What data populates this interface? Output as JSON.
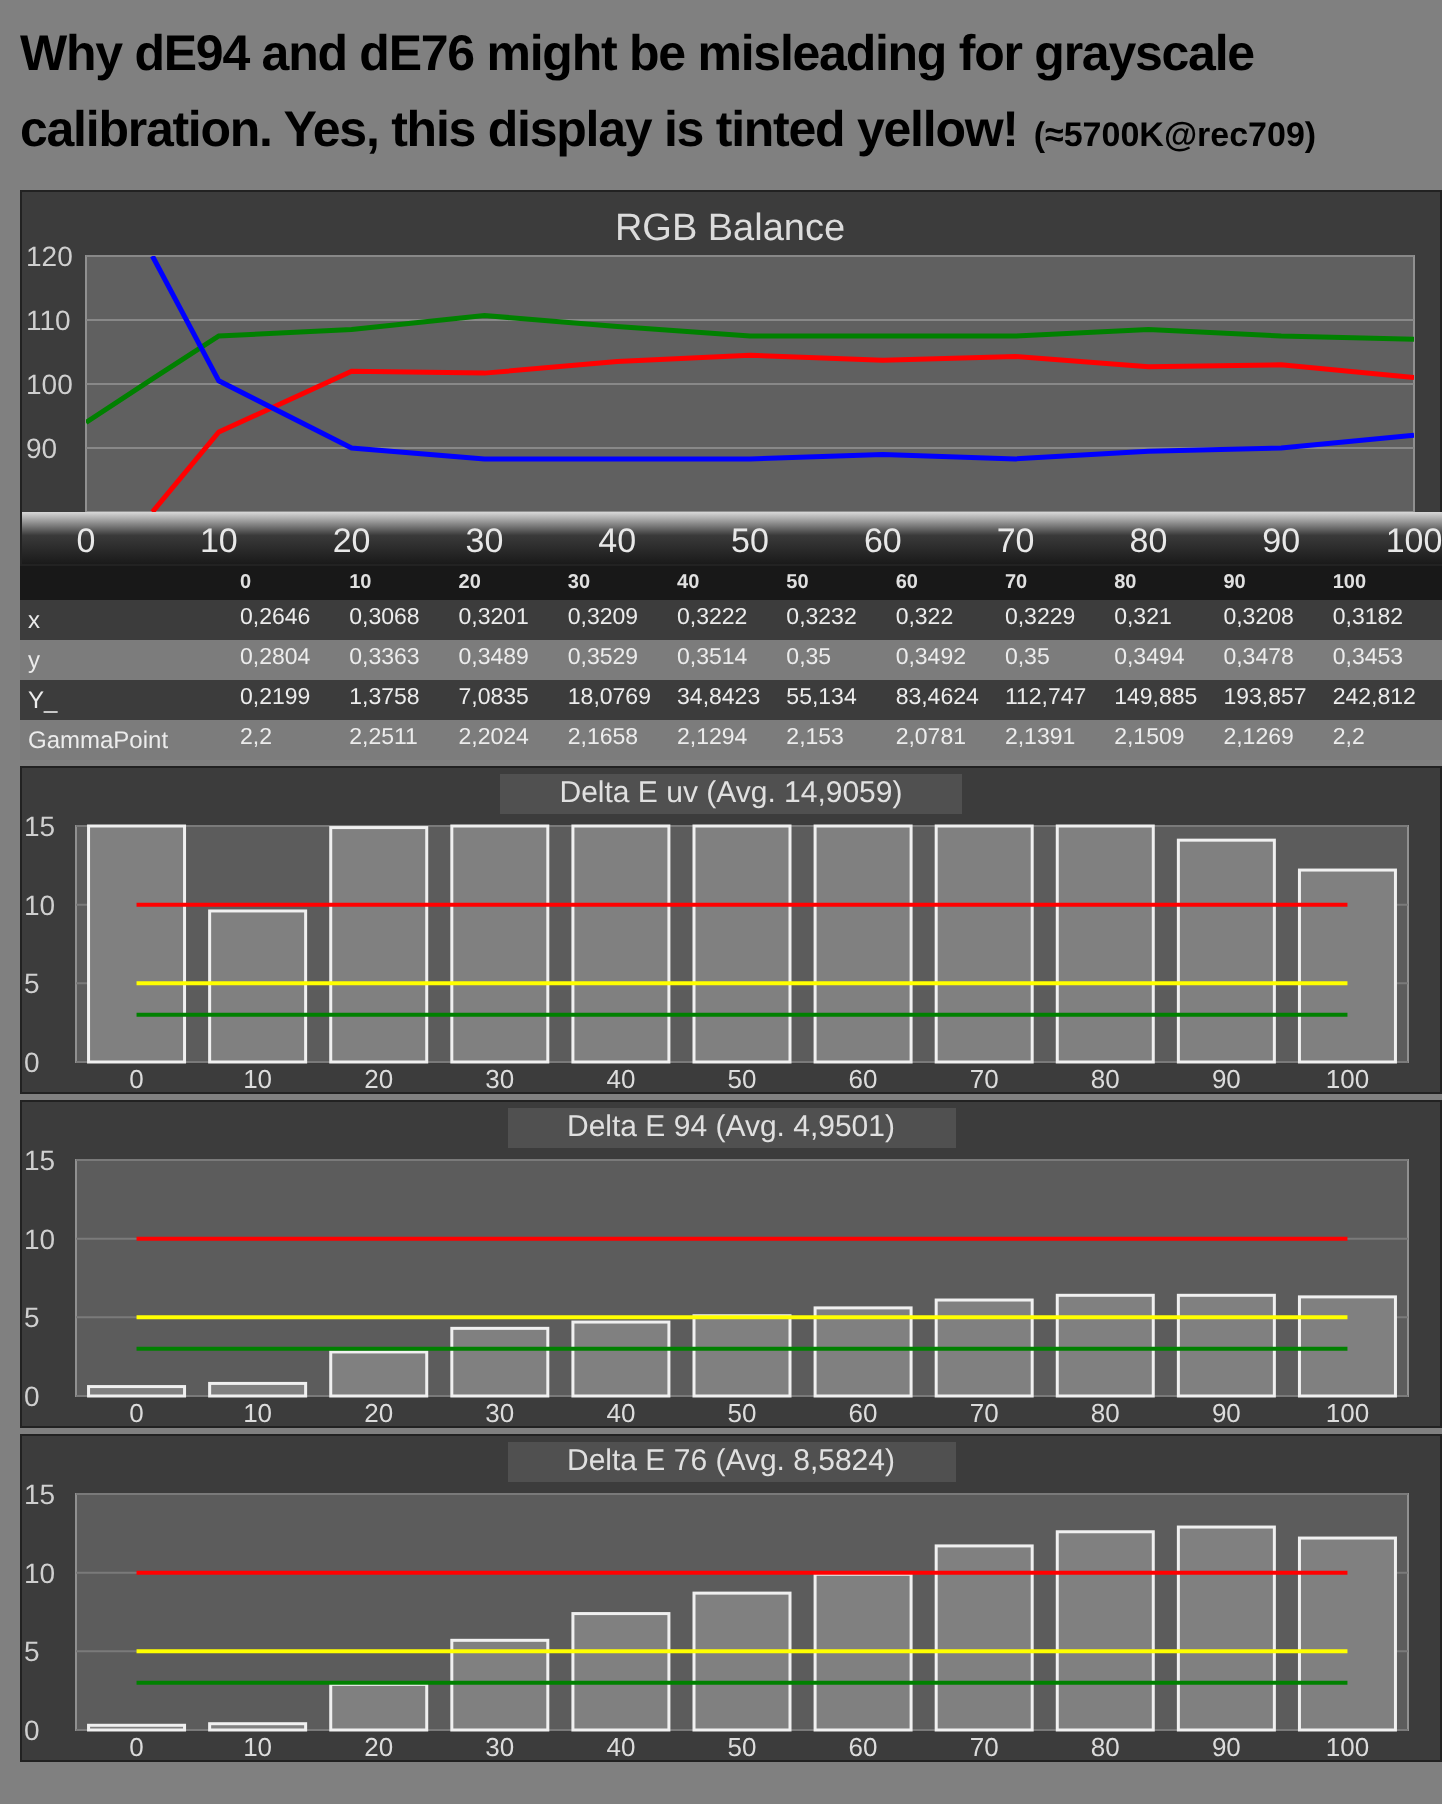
{
  "headline": {
    "line1": "Why dE94 and dE76 might be misleading for grayscale",
    "line2": "calibration. Yes, this display is tinted yellow!",
    "note": "(≈5700K@rec709)"
  },
  "rgb_balance": {
    "chart_data": {
      "type": "line",
      "title": "RGB Balance",
      "grid": true,
      "x": [
        0,
        5,
        10,
        20,
        30,
        40,
        50,
        60,
        70,
        80,
        90,
        100
      ],
      "xlim": [
        0,
        100
      ],
      "ylim": [
        80,
        120
      ],
      "yticks": [
        90,
        100,
        110,
        120
      ],
      "xticks": [
        0,
        10,
        20,
        30,
        40,
        50,
        60,
        70,
        80,
        90,
        100
      ],
      "series": [
        {
          "color": "#ff0000",
          "values": [
            null,
            80,
            92.5,
            102,
            101.7,
            103.5,
            104.5,
            103.7,
            104.3,
            102.7,
            103,
            101
          ]
        },
        {
          "color": "#008000",
          "values": [
            94,
            100.8,
            107.5,
            108.5,
            110.7,
            109,
            107.5,
            107.5,
            107.5,
            108.5,
            107.5,
            107
          ]
        },
        {
          "color": "#0000ff",
          "values": [
            null,
            120,
            100.5,
            90,
            88.3,
            88.3,
            88.3,
            89,
            88.3,
            89.5,
            90,
            92
          ]
        }
      ]
    }
  },
  "table": {
    "columns": [
      "0",
      "10",
      "20",
      "30",
      "40",
      "50",
      "60",
      "70",
      "80",
      "90",
      "100"
    ],
    "rows": [
      {
        "label": "x",
        "cells": [
          "0,2646",
          "0,3068",
          "0,3201",
          "0,3209",
          "0,3222",
          "0,3232",
          "0,322",
          "0,3229",
          "0,321",
          "0,3208",
          "0,3182"
        ]
      },
      {
        "label": "y",
        "cells": [
          "0,2804",
          "0,3363",
          "0,3489",
          "0,3529",
          "0,3514",
          "0,35",
          "0,3492",
          "0,35",
          "0,3494",
          "0,3478",
          "0,3453"
        ]
      },
      {
        "label": "Y_",
        "cells": [
          "0,2199",
          "1,3758",
          "7,0835",
          "18,0769",
          "34,8423",
          "55,134",
          "83,4624",
          "112,747",
          "149,885",
          "193,857",
          "242,812"
        ]
      },
      {
        "label": "GammaPoint",
        "cells": [
          "2,2",
          "2,2511",
          "2,2024",
          "2,1658",
          "2,1294",
          "2,153",
          "2,0781",
          "2,1391",
          "2,1509",
          "2,1269",
          "2,2"
        ]
      }
    ]
  },
  "delta_charts": [
    {
      "chart_data": {
        "type": "bar",
        "title": "Delta E uv (Avg. 14,9059)",
        "categories": [
          "0",
          "10",
          "20",
          "30",
          "40",
          "50",
          "60",
          "70",
          "80",
          "90",
          "100"
        ],
        "values": [
          15,
          9.6,
          14.9,
          15,
          15,
          15,
          15,
          15,
          15,
          14.1,
          12.2
        ],
        "ylim": [
          0,
          15
        ],
        "yticks": [
          0,
          5,
          10,
          15
        ],
        "grid": true,
        "ref_lines": [
          {
            "axis": "y",
            "value": 10,
            "color": "#ff0000"
          },
          {
            "axis": "y",
            "value": 5,
            "color": "#ffff00"
          },
          {
            "axis": "y",
            "value": 3,
            "color": "#008000"
          }
        ]
      }
    },
    {
      "chart_data": {
        "type": "bar",
        "title": "Delta E 94 (Avg. 4,9501)",
        "categories": [
          "0",
          "10",
          "20",
          "30",
          "40",
          "50",
          "60",
          "70",
          "80",
          "90",
          "100"
        ],
        "values": [
          0.6,
          0.8,
          2.8,
          4.3,
          4.7,
          5.1,
          5.6,
          6.1,
          6.4,
          6.4,
          6.3
        ],
        "ylim": [
          0,
          15
        ],
        "yticks": [
          0,
          5,
          10,
          15
        ],
        "grid": true,
        "ref_lines": [
          {
            "axis": "y",
            "value": 10,
            "color": "#ff0000"
          },
          {
            "axis": "y",
            "value": 5,
            "color": "#ffff00"
          },
          {
            "axis": "y",
            "value": 3,
            "color": "#008000"
          }
        ]
      }
    },
    {
      "chart_data": {
        "type": "bar",
        "title": "Delta E 76 (Avg. 8,5824)",
        "categories": [
          "0",
          "10",
          "20",
          "30",
          "40",
          "50",
          "60",
          "70",
          "80",
          "90",
          "100"
        ],
        "values": [
          0.3,
          0.4,
          2.9,
          5.7,
          7.4,
          8.7,
          9.9,
          11.7,
          12.6,
          12.9,
          12.2
        ],
        "ylim": [
          0,
          15
        ],
        "yticks": [
          0,
          5,
          10,
          15
        ],
        "grid": true,
        "ref_lines": [
          {
            "axis": "y",
            "value": 10,
            "color": "#ff0000"
          },
          {
            "axis": "y",
            "value": 5,
            "color": "#ffff00"
          },
          {
            "axis": "y",
            "value": 3,
            "color": "#008000"
          }
        ]
      }
    }
  ]
}
